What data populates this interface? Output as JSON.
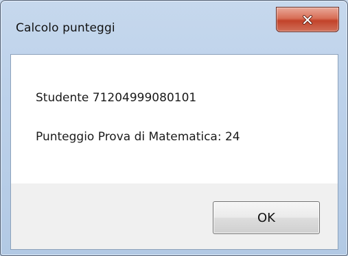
{
  "window": {
    "title": "Calcolo punteggi",
    "close_icon": "close-icon"
  },
  "message": {
    "line1": "Studente 71204999080101",
    "line2": "Punteggio Prova di Matematica: 24"
  },
  "buttons": {
    "ok_label": "OK"
  },
  "colors": {
    "frame": "#bcd1ea",
    "close_button": "#c2432a",
    "content_background": "#ffffff",
    "button_area": "#f0f0f0"
  }
}
